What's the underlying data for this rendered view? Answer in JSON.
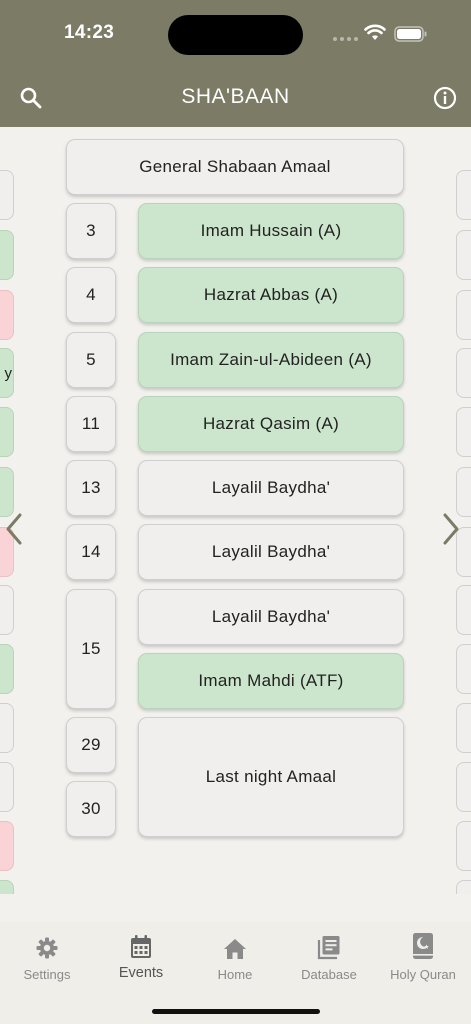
{
  "status": {
    "time": "14:23"
  },
  "appbar": {
    "title": "SHA'BAAN"
  },
  "general": {
    "label": "General Shabaan Amaal"
  },
  "rows": [
    {
      "day": "3",
      "events": [
        {
          "label": "Imam Hussain (A)",
          "color": "green"
        }
      ]
    },
    {
      "day": "4",
      "events": [
        {
          "label": "Hazrat Abbas (A)",
          "color": "green"
        }
      ]
    },
    {
      "day": "5",
      "events": [
        {
          "label": "Imam Zain-ul-Abideen (A)",
          "color": "green"
        }
      ]
    },
    {
      "day": "11",
      "events": [
        {
          "label": "Hazrat Qasim (A)",
          "color": "green"
        }
      ]
    },
    {
      "day": "13",
      "events": [
        {
          "label": "Layalil Baydha'",
          "color": "plain"
        }
      ]
    },
    {
      "day": "14",
      "events": [
        {
          "label": "Layalil Baydha'",
          "color": "plain"
        }
      ]
    },
    {
      "day": "15",
      "events": [
        {
          "label": "Layalil Baydha'",
          "color": "plain"
        },
        {
          "label": "Imam Mahdi (ATF)",
          "color": "green"
        }
      ]
    }
  ],
  "last": {
    "days": [
      "29",
      "30"
    ],
    "label": "Last night Amaal"
  },
  "left_peek_fragment": "y",
  "colors": {
    "appbar": "#7b7b66",
    "green": "#cce6cd",
    "pink": "#fad3d6",
    "card": "#f0efed"
  },
  "nav": [
    {
      "label": "Settings",
      "icon": "gear-icon"
    },
    {
      "label": "Events",
      "icon": "calendar-icon",
      "active": true
    },
    {
      "label": "Home",
      "icon": "home-icon"
    },
    {
      "label": "Database",
      "icon": "database-icon"
    },
    {
      "label": "Holy Quran",
      "icon": "quran-icon"
    }
  ]
}
